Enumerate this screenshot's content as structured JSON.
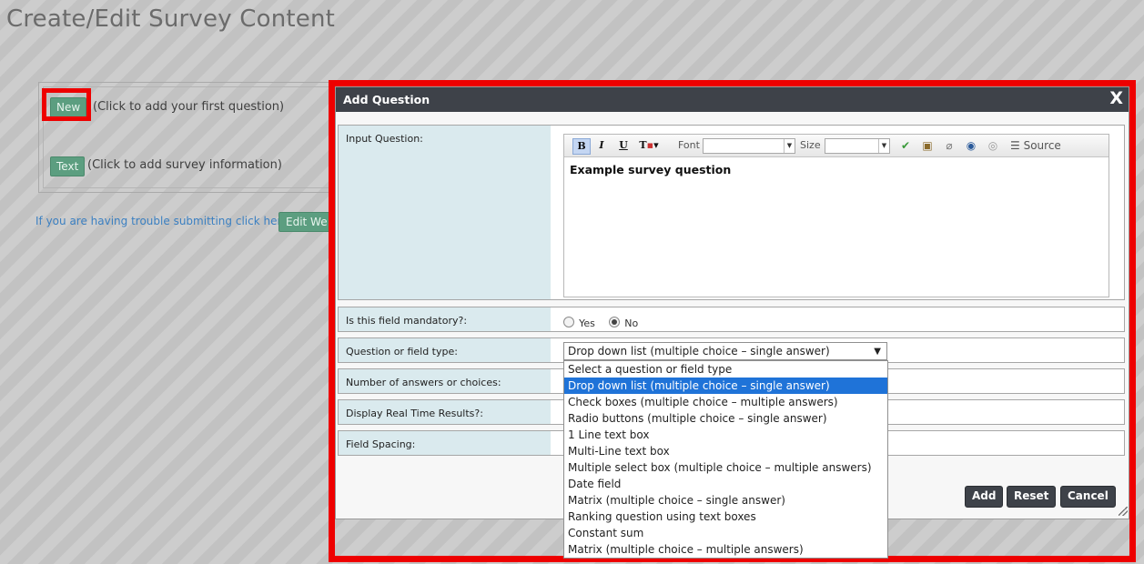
{
  "page": {
    "title": "Create/Edit Survey Content"
  },
  "survey_panel": {
    "new_button": "New",
    "new_hint": "(Click to add your first question)",
    "text_button": "Text",
    "text_hint": "(Click to add survey information)",
    "trouble_link": "If you are having trouble submitting click here.",
    "edit_button": "Edit We"
  },
  "dialog": {
    "title": "Add Question",
    "close_glyph": "X",
    "input_question_label": "Input Question:",
    "editor": {
      "font_label": "Font",
      "size_label": "Size",
      "source_label": "Source",
      "content": "Example survey question"
    },
    "mandatory": {
      "label": "Is this field mandatory?:",
      "yes": "Yes",
      "no": "No",
      "selected": "No"
    },
    "field_type": {
      "label": "Question or field type:",
      "selected": "Drop down list (multiple choice – single answer)",
      "options": [
        "Select a question or field type",
        "Drop down list (multiple choice – single answer)",
        "Check boxes (multiple choice – multiple answers)",
        "Radio buttons (multiple choice – single answer)",
        "1 Line text box",
        "Multi-Line text box",
        "Multiple select box (multiple choice – multiple answers)",
        "Date field",
        "Matrix (multiple choice – single answer)",
        "Ranking question using text boxes",
        "Constant sum",
        "Matrix (multiple choice – multiple answers)"
      ]
    },
    "num_answers_label": "Number of answers or choices:",
    "realtime_label": "Display Real Time Results?:",
    "spacing_label": "Field Spacing:",
    "buttons": {
      "add": "Add",
      "reset": "Reset",
      "cancel": "Cancel"
    }
  },
  "colors": {
    "highlight": "#ee0000",
    "dialog_header": "#3e4249",
    "label_bg": "#daeaee",
    "green_button": "#5c9e80",
    "selected_option": "#1f73d8"
  }
}
